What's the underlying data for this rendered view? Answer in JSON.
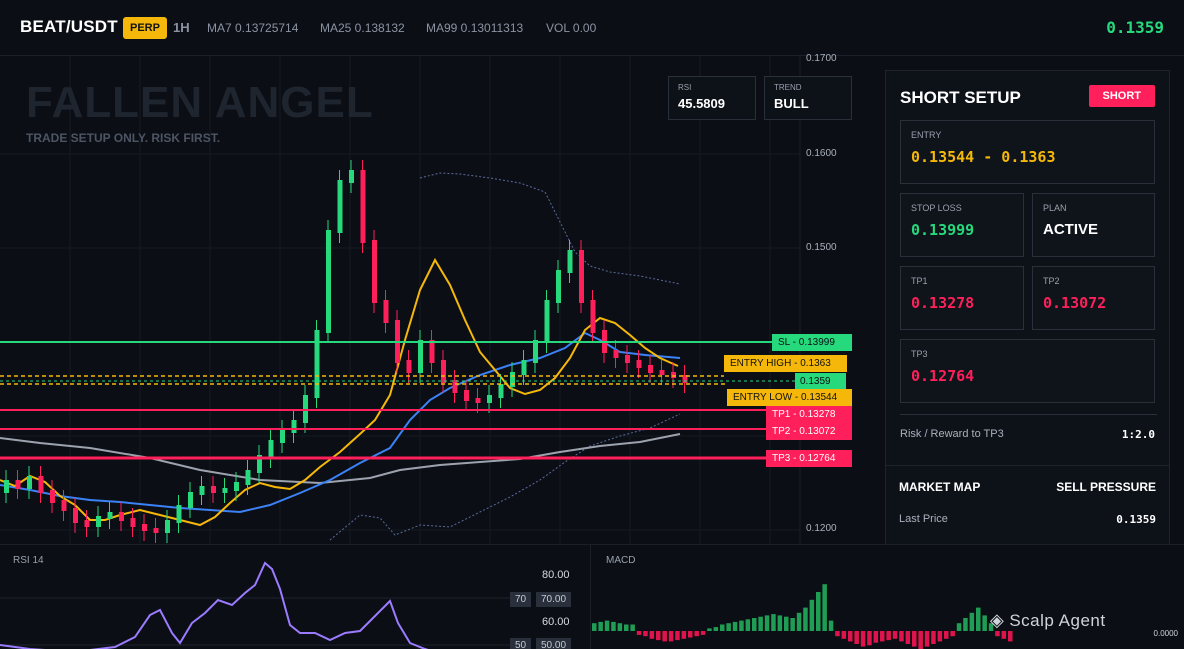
{
  "header": {
    "pair": "BEAT/USDT",
    "badge": "PERP",
    "timeframe": "1H",
    "ma7": "MA7 0.13725714",
    "ma25": "MA25 0.138132",
    "ma99": "MA99 0.13011313",
    "vol": "VOL 0.00",
    "last_price": "0.1359"
  },
  "chart": {
    "watermark": "FALLEN ANGEL",
    "tagline": "TRADE SETUP ONLY. RISK FIRST.",
    "rsi_label": "RSI",
    "rsi_value": "45.5809",
    "trend_label": "TREND",
    "trend_value": "BULL",
    "y_ticks": [
      "0.1700",
      "0.1600",
      "0.1500",
      "0.1200"
    ],
    "levels": {
      "sl": {
        "label": "SL",
        "value": "0.13999"
      },
      "entry_high": {
        "label": "ENTRY HIGH",
        "value": "0.1363"
      },
      "last": {
        "value": "0.1359"
      },
      "entry_low": {
        "label": "ENTRY LOW",
        "value": "0.13544"
      },
      "tp1": {
        "label": "TP1",
        "value": "0.13278"
      },
      "tp2": {
        "label": "TP2",
        "value": "0.13072"
      },
      "tp3": {
        "label": "TP3",
        "value": "0.12764"
      }
    }
  },
  "setup": {
    "title": "SHORT SETUP",
    "badge": "SHORT",
    "entry_label": "ENTRY",
    "entry_value": "0.13544 - 0.1363",
    "stop_label": "STOP LOSS",
    "stop_value": "0.13999",
    "plan_label": "PLAN",
    "plan_value": "ACTIVE",
    "tp1_label": "TP1",
    "tp1_value": "0.13278",
    "tp2_label": "TP2",
    "tp2_value": "0.13072",
    "tp3_label": "TP3",
    "tp3_value": "0.12764",
    "rr_label": "Risk / Reward to TP3",
    "rr_value": "1:2.0"
  },
  "market_map": {
    "title": "MARKET MAP",
    "pressure": "SELL PRESSURE",
    "last_label": "Last Price",
    "last_value": "0.1359"
  },
  "indicators": {
    "rsi_title": "RSI 14",
    "rsi_ticks": [
      "80.00",
      "70.00",
      "60.00",
      "50.00"
    ],
    "rsi_box_70": "70",
    "rsi_box_50": "50",
    "macd_title": "MACD"
  },
  "brand": {
    "name": "Scalp Agent",
    "sub": "0.0000"
  },
  "colors": {
    "bull": "#26d97c",
    "bear": "#ff1f5a",
    "entry": "#f5b80a",
    "ma_fast": "#f5b80a",
    "ma_mid": "#3b82f6",
    "ma_slow": "#9ca3af"
  }
}
